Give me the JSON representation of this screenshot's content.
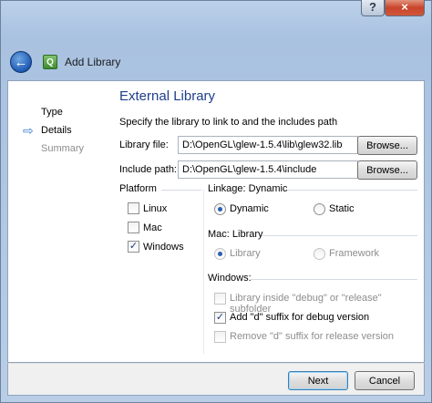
{
  "window": {
    "help_glyph": "?",
    "close_glyph": "×",
    "title": "Add Library",
    "back_glyph": "←",
    "app_icon_glyph": "Q"
  },
  "steps": [
    {
      "label": "Type",
      "state": "done"
    },
    {
      "label": "Details",
      "state": "current"
    },
    {
      "label": "Summary",
      "state": "pending"
    }
  ],
  "page": {
    "title": "External Library",
    "description": "Specify the library to link to and the includes path"
  },
  "fields": {
    "library_file": {
      "label": "Library file:",
      "value": "D:\\OpenGL\\glew-1.5.4\\lib\\glew32.lib",
      "button": "Browse..."
    },
    "include_path": {
      "label": "Include path:",
      "value": "D:\\OpenGL\\glew-1.5.4\\include",
      "button": "Browse..."
    }
  },
  "platform": {
    "title": "Platform",
    "options": [
      {
        "label": "Linux",
        "checked": false
      },
      {
        "label": "Mac",
        "checked": false
      },
      {
        "label": "Windows",
        "checked": true
      }
    ]
  },
  "linkage": {
    "title": "Linkage: Dynamic",
    "options": [
      {
        "label": "Dynamic",
        "selected": true
      },
      {
        "label": "Static",
        "selected": false
      }
    ]
  },
  "mac": {
    "title": "Mac: Library",
    "options": [
      {
        "label": "Library",
        "selected": true,
        "disabled": true
      },
      {
        "label": "Framework",
        "selected": false,
        "disabled": true
      }
    ]
  },
  "windows": {
    "title": "Windows:",
    "options": [
      {
        "label": "Library inside \"debug\" or \"release\" subfolder",
        "checked": false,
        "disabled": true
      },
      {
        "label": "Add \"d\" suffix for debug version",
        "checked": true,
        "disabled": false
      },
      {
        "label": "Remove \"d\" suffix for release version",
        "checked": false,
        "disabled": true
      }
    ]
  },
  "footer": {
    "next": "Next",
    "cancel": "Cancel"
  },
  "check_glyph": "✓"
}
